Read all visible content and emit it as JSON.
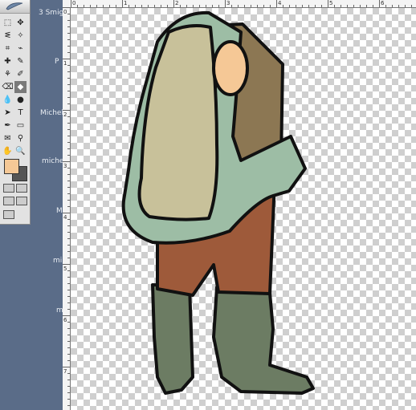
{
  "desktop": {
    "labels": [
      "3 Smigo",
      "P",
      "Michel",
      "miche",
      "M",
      "mi",
      "m"
    ]
  },
  "toolbox": {
    "tools": [
      "marquee-tool",
      "move-tool",
      "lasso-tool",
      "magic-wand-tool",
      "crop-tool",
      "slice-tool",
      "healing-brush-tool",
      "brush-tool",
      "clone-stamp-tool",
      "history-brush-tool",
      "eraser-tool",
      "paint-bucket-tool",
      "blur-tool",
      "dodge-tool",
      "path-select-tool",
      "type-tool",
      "pen-tool",
      "shape-tool",
      "notes-tool",
      "eyedropper-tool",
      "hand-tool",
      "zoom-tool"
    ],
    "glyphs": [
      "⬚",
      "✥",
      "ᓬ",
      "✧",
      "⌗",
      "⌁",
      "✚",
      "✎",
      "⚘",
      "✐",
      "⌫",
      "◆",
      "💧",
      "●",
      "➤",
      "T",
      "✒",
      "▭",
      "✉",
      "⚲",
      "✋",
      "🔍"
    ],
    "active_tool_index": 11,
    "foreground_color": "#f5c896",
    "background_color": "#555555"
  },
  "ruler": {
    "top_numbers": [
      "0",
      "1",
      "2",
      "3",
      "4",
      "5",
      "6",
      "7"
    ],
    "left_numbers": [
      "0",
      "1",
      "2",
      "3",
      "4",
      "5",
      "6",
      "7"
    ]
  },
  "figure_colors": {
    "coat": "#9dbda5",
    "lining": "#c8c19a",
    "shirt": "#8c7753",
    "face": "#f5c896",
    "pants": "#9e5a3a",
    "boots": "#6c7c63",
    "belt": "#c9a58a"
  }
}
